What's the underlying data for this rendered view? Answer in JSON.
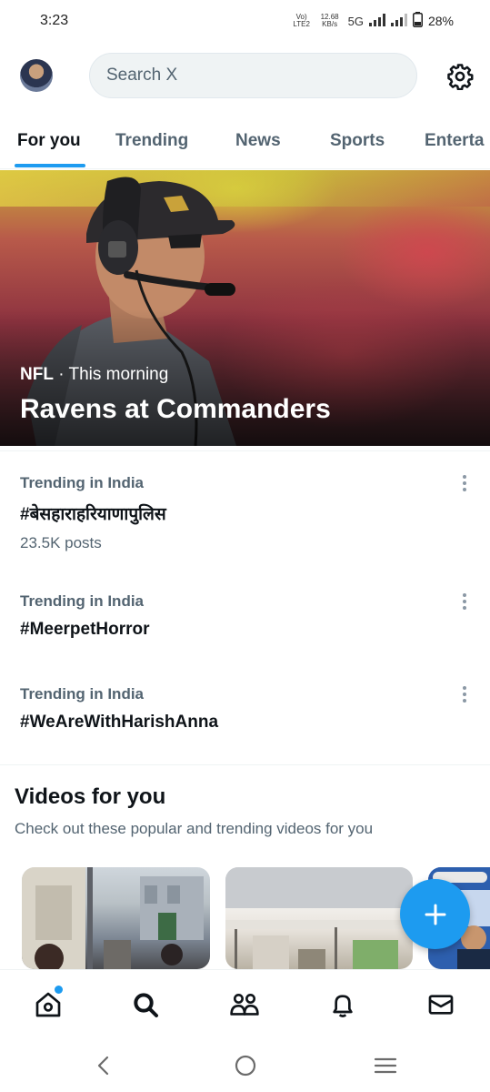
{
  "status_bar": {
    "time": "3:23",
    "network_small_top": "Vo) LTE2",
    "speed": "12.68 KB/s",
    "network_type": "5G",
    "battery_percent": "28%"
  },
  "header": {
    "search_placeholder": "Search X"
  },
  "tabs": [
    {
      "label": "For you",
      "active": true
    },
    {
      "label": "Trending",
      "active": false
    },
    {
      "label": "News",
      "active": false
    },
    {
      "label": "Sports",
      "active": false
    },
    {
      "label": "Enterta",
      "active": false
    }
  ],
  "hero": {
    "source": "NFL",
    "time": " · This morning",
    "title": "Ravens at Commanders"
  },
  "trends": [
    {
      "context": "Trending in India",
      "name": "#बेसहाराहरियाणापुलिस",
      "count": "23.5K posts"
    },
    {
      "context": "Trending in India",
      "name": "#MeerpetHorror"
    },
    {
      "context": "Trending in India",
      "name": "#WeAreWithHarishAnna"
    }
  ],
  "videos": {
    "title": "Videos for you",
    "subtitle": "Check out these popular and trending videos for you"
  },
  "colors": {
    "accent": "#1d9bf0",
    "text_primary": "#0f1419",
    "text_secondary": "#536471"
  },
  "icons": {
    "settings": "gear-icon",
    "home": "home-icon",
    "search": "search-icon",
    "communities": "people-icon",
    "notifications": "bell-icon",
    "messages": "envelope-icon",
    "compose": "plus-icon"
  }
}
